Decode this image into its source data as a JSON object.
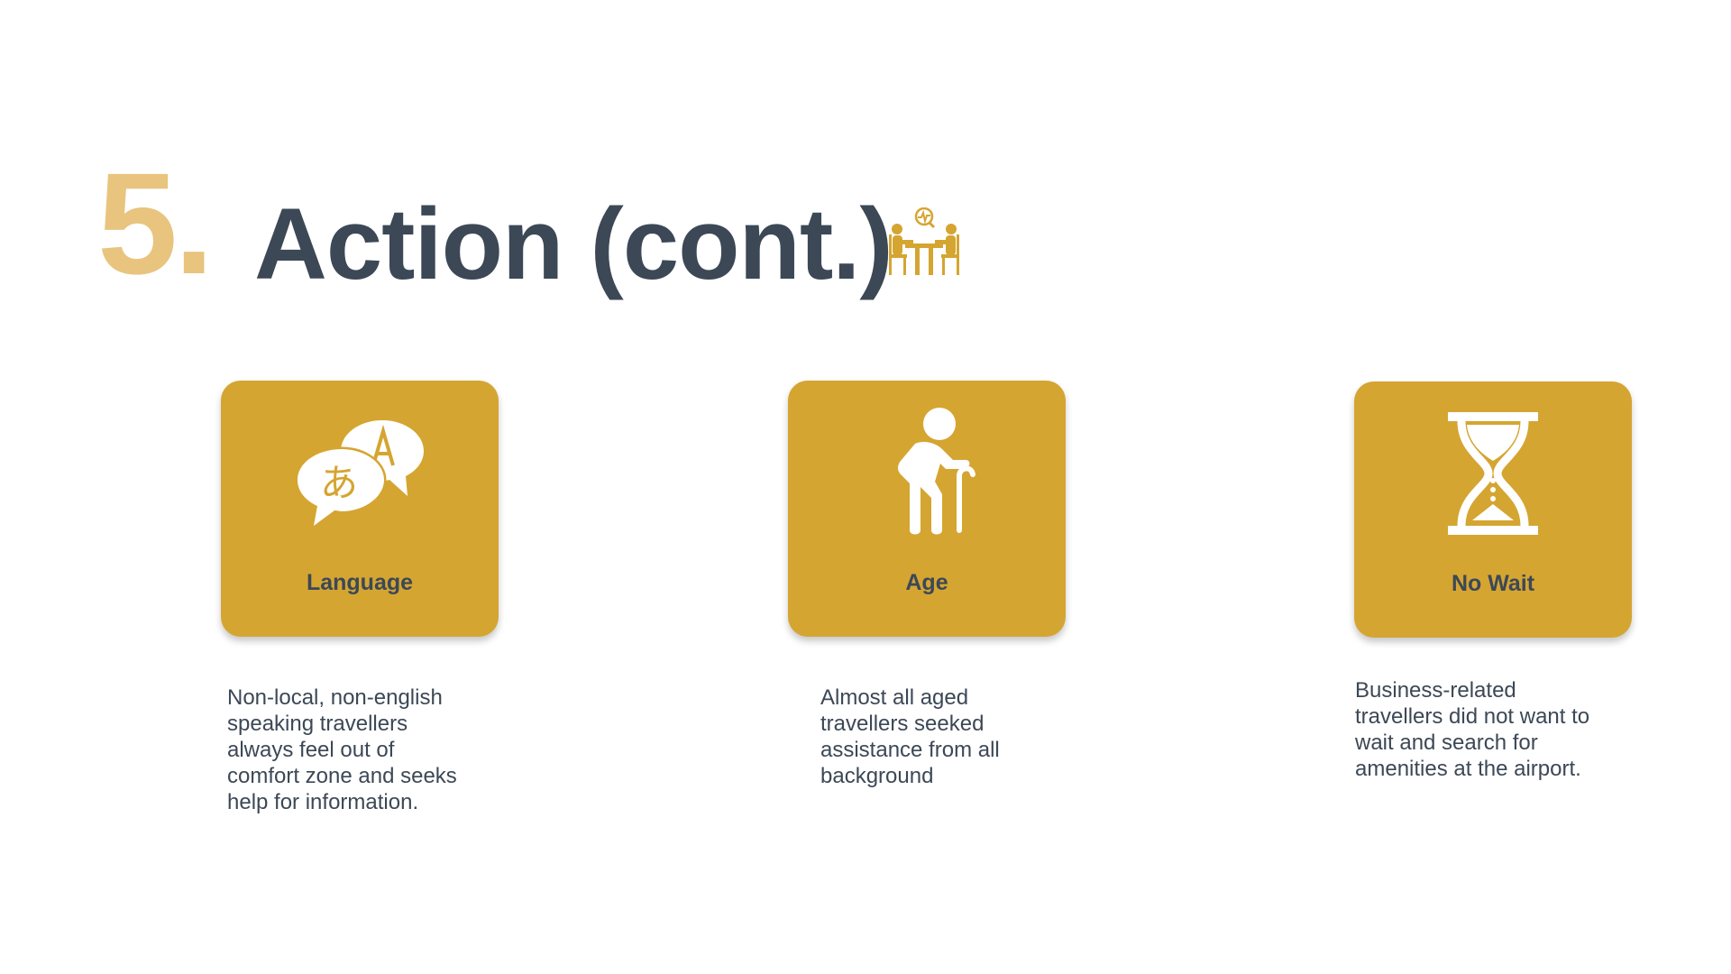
{
  "colors": {
    "accent_light": "#E8C47E",
    "accent": "#D5A531",
    "dark": "#3C4856",
    "icon_fill": "#FFFFFF",
    "background": "#FFFFFF"
  },
  "header": {
    "number": "5.",
    "title": "Action (cont.)",
    "icon": "meeting-icon"
  },
  "cards": [
    {
      "label": "Language",
      "icon": "language-translate-icon",
      "description": "Non-local, non-english\nspeaking travellers\nalways feel out of\ncomfort zone and seeks\nhelp for information."
    },
    {
      "label": "Age",
      "icon": "elderly-person-icon",
      "description": "Almost all aged\ntravellers seeked\nassistance from all\nbackground"
    },
    {
      "label": "No Wait",
      "icon": "hourglass-icon",
      "description": "Business-related\ntravellers did not want to\nwait and search for\namenities at the airport."
    }
  ]
}
